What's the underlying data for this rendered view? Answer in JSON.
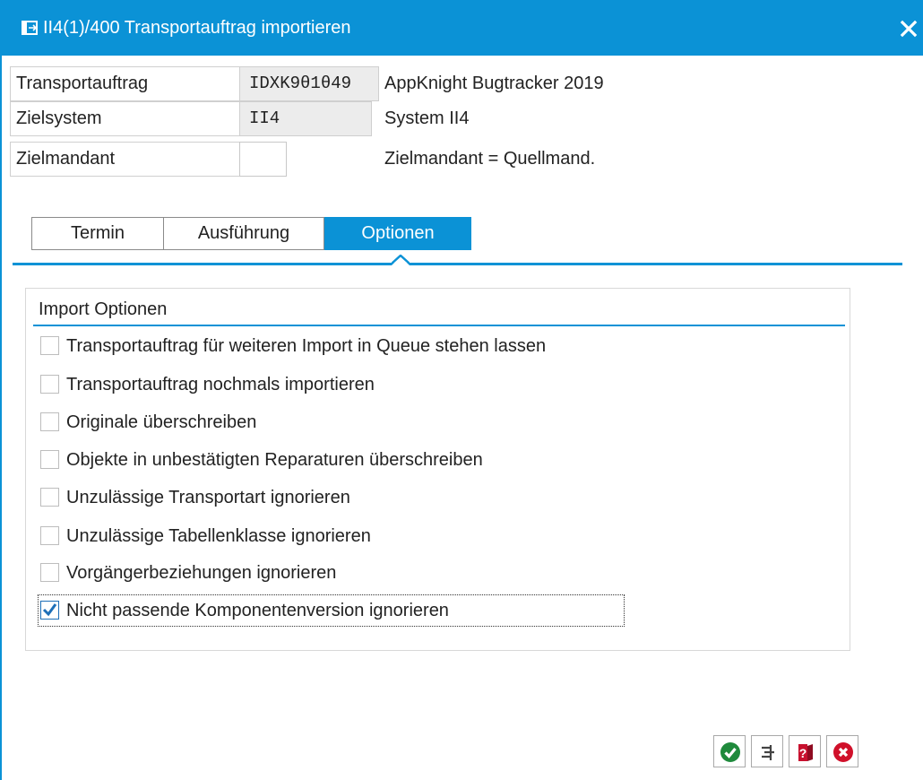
{
  "window": {
    "title": "II4(1)/400 Transportauftrag importieren",
    "icons": {
      "app": "dialog-icon",
      "close": "close-icon"
    }
  },
  "header": {
    "fields": [
      {
        "label": "Transportauftrag",
        "value": "IDXK9θ1θ49",
        "description": "AppKnight Bugtracker 2019"
      },
      {
        "label": "Zielsystem",
        "value": "II4",
        "description": "System II4"
      },
      {
        "label": "Zielmandant",
        "value": "",
        "description": "Zielmandant = Quellmand."
      }
    ]
  },
  "tabs": [
    {
      "label": "Termin",
      "active": false
    },
    {
      "label": "Ausführung",
      "active": false
    },
    {
      "label": "Optionen",
      "active": true
    }
  ],
  "options_group": {
    "title": "Import Optionen",
    "items": [
      {
        "label": "Transportauftrag für weiteren Import in Queue stehen lassen",
        "checked": false
      },
      {
        "label": "Transportauftrag nochmals importieren",
        "checked": false
      },
      {
        "label": "Originale überschreiben",
        "checked": false
      },
      {
        "label": "Objekte in unbestätigten Reparaturen überschreiben",
        "checked": false
      },
      {
        "label": "Unzulässige Transportart ignorieren",
        "checked": false
      },
      {
        "label": "Unzulässige Tabellenklasse ignorieren",
        "checked": false
      },
      {
        "label": "Vorgängerbeziehungen ignorieren",
        "checked": false
      },
      {
        "label": "Nicht passende Komponentenversion ignorieren",
        "checked": true
      }
    ]
  },
  "buttons": [
    {
      "name": "confirm",
      "icon": "check-circle-icon",
      "color": "#1f8a3c"
    },
    {
      "name": "step",
      "icon": "step-icon",
      "color": "#444444"
    },
    {
      "name": "help",
      "icon": "help-book-icon",
      "color": "#c8102e"
    },
    {
      "name": "cancel",
      "icon": "cancel-circle-icon",
      "color": "#d0102a"
    }
  ],
  "colors": {
    "accent": "#0b92d6"
  }
}
